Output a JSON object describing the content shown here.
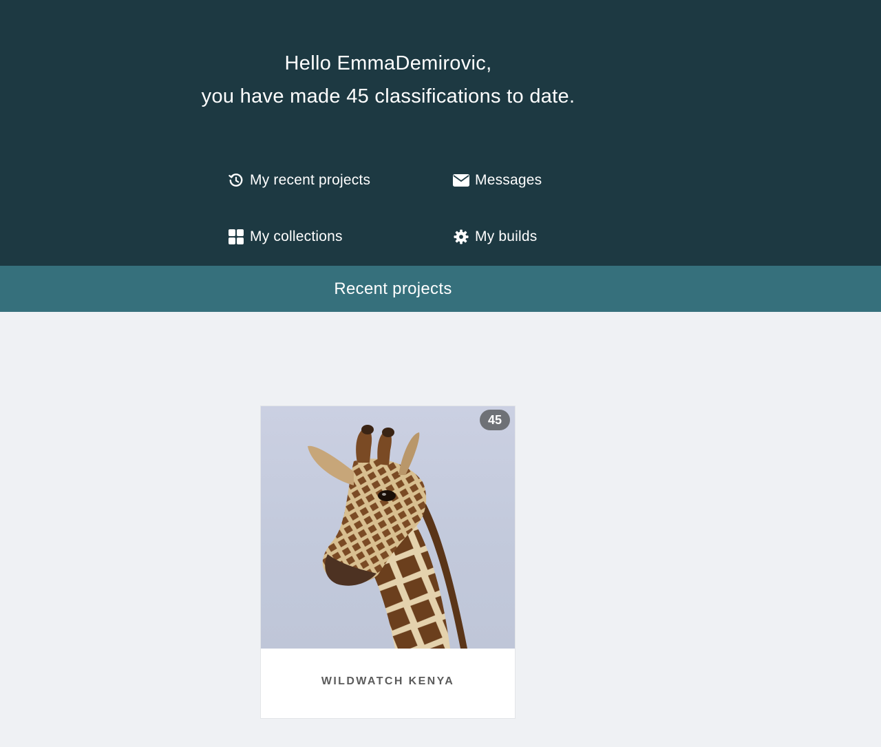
{
  "greeting": {
    "line1": "Hello EmmaDemirovic,",
    "line2": "you have made 45 classifications to date."
  },
  "nav": {
    "recent_projects": {
      "label": "My recent projects",
      "icon": "history-icon"
    },
    "messages": {
      "label": "Messages",
      "icon": "envelope-icon"
    },
    "collections": {
      "label": "My collections",
      "icon": "grid-icon"
    },
    "builds": {
      "label": "My builds",
      "icon": "gear-icon"
    }
  },
  "recent_section": {
    "title": "Recent projects"
  },
  "projects": [
    {
      "name": "WILDWATCH KENYA",
      "classification_count": "45",
      "image": "giraffe-photo"
    }
  ],
  "colors": {
    "hero_bg": "#1d3942",
    "section_bar_bg": "#36707c",
    "page_bg": "#eff1f4",
    "badge_bg": "#6e7176"
  }
}
